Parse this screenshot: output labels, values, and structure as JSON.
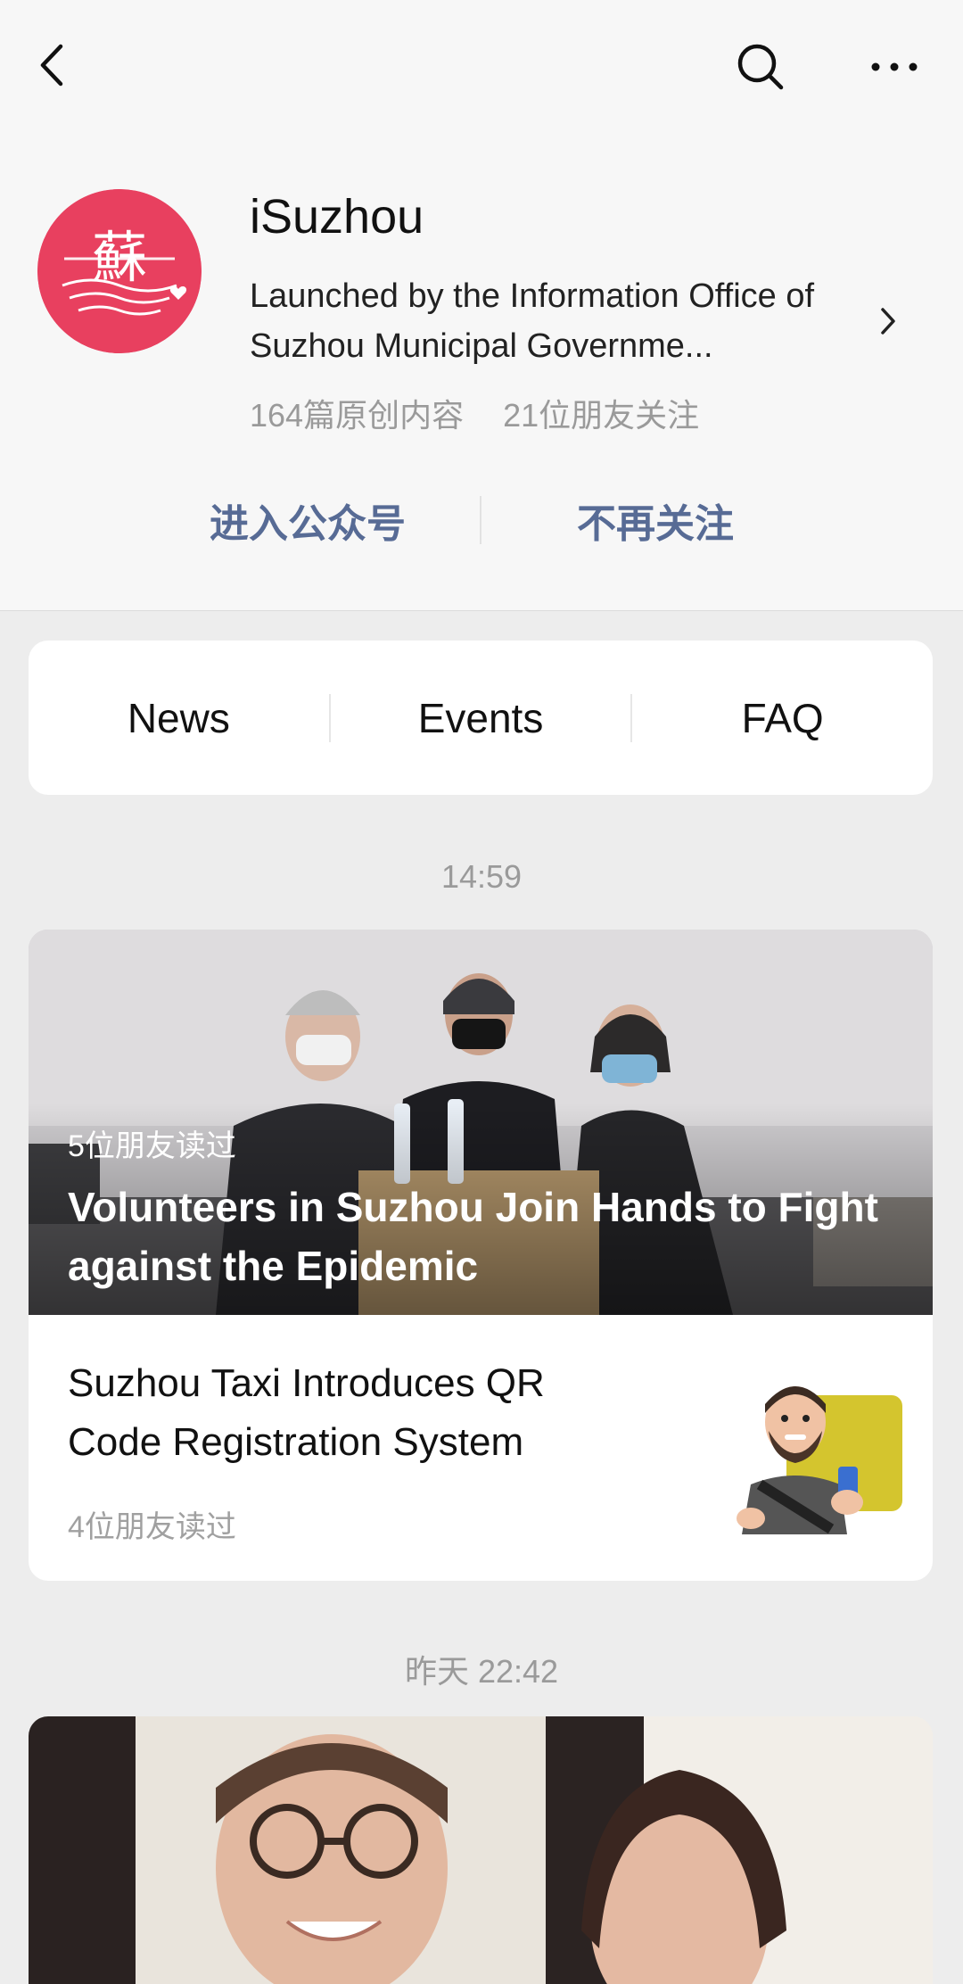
{
  "header": {
    "back_icon": "chevron-left-icon",
    "search_icon": "search-icon",
    "more_icon": "more-horizontal-icon"
  },
  "profile": {
    "name": "iSuzhou",
    "description": "Launched by the Information Office of Suzhou Municipal Governme...",
    "original_count": "164篇原创内容",
    "friends_following": "21位朋友关注",
    "avatar_glyph": "蘇",
    "brand_color": "#e8405f"
  },
  "actions": {
    "enter": "进入公众号",
    "unfollow": "不再关注",
    "color": "#576b95"
  },
  "menu": {
    "items": [
      "News",
      "Events",
      "FAQ"
    ]
  },
  "feed": [
    {
      "time": "14:59",
      "main": {
        "read_count": "5位朋友读过",
        "title": "Volunteers in Suzhou Join Hands to Fight against  the Epidemic"
      },
      "sub": {
        "title": "Suzhou Taxi Introduces QR Code Registration System",
        "read_count": "4位朋友读过"
      }
    },
    {
      "time": "昨天 22:42"
    }
  ]
}
